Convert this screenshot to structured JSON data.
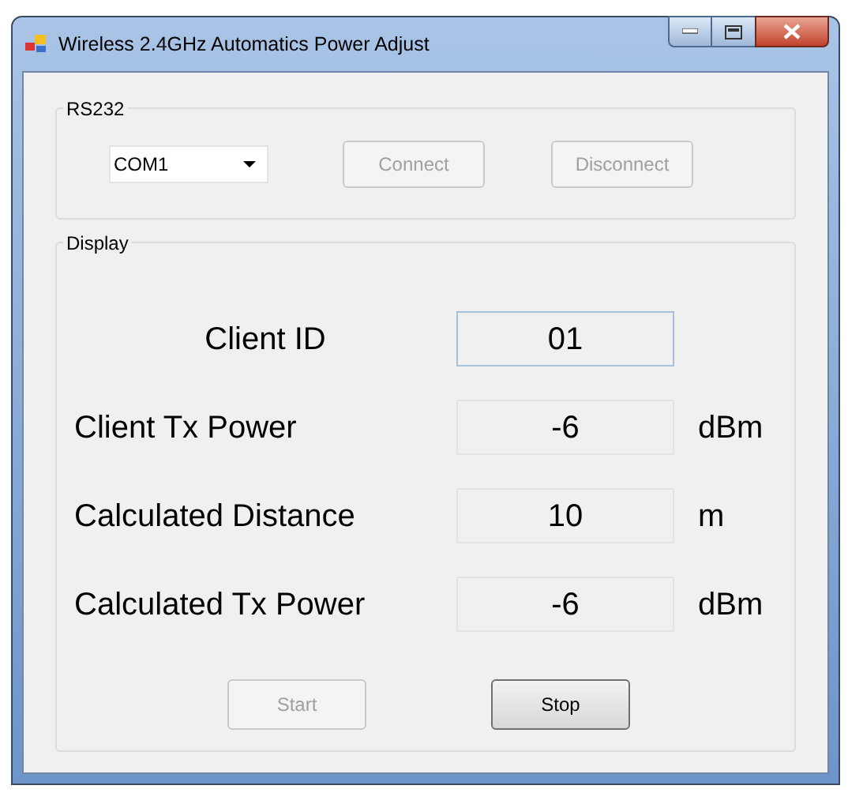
{
  "window": {
    "title": "Wireless 2.4GHz Automatics Power Adjust"
  },
  "rs232": {
    "title": "RS232",
    "port": "COM1",
    "buttons": [
      {
        "label": "Connect",
        "disabled": true
      },
      {
        "label": "Disconnect",
        "disabled": true
      }
    ]
  },
  "display": {
    "title": "Display",
    "rows": [
      {
        "kind": "focused",
        "label": "Client ID",
        "value": "01"
      },
      {
        "kind": "plain",
        "label": "Client Tx Power",
        "value": "-6",
        "unit": "dBm"
      },
      {
        "kind": "plain",
        "label": "Calculated Distance",
        "value": "10",
        "unit": "m"
      },
      {
        "kind": "plain",
        "label": "Calculated Tx Power",
        "value": "-6",
        "unit": "dBm"
      }
    ],
    "buttons": [
      {
        "label": "Start",
        "disabled": true
      },
      {
        "label": "Stop",
        "disabled": false
      }
    ]
  }
}
